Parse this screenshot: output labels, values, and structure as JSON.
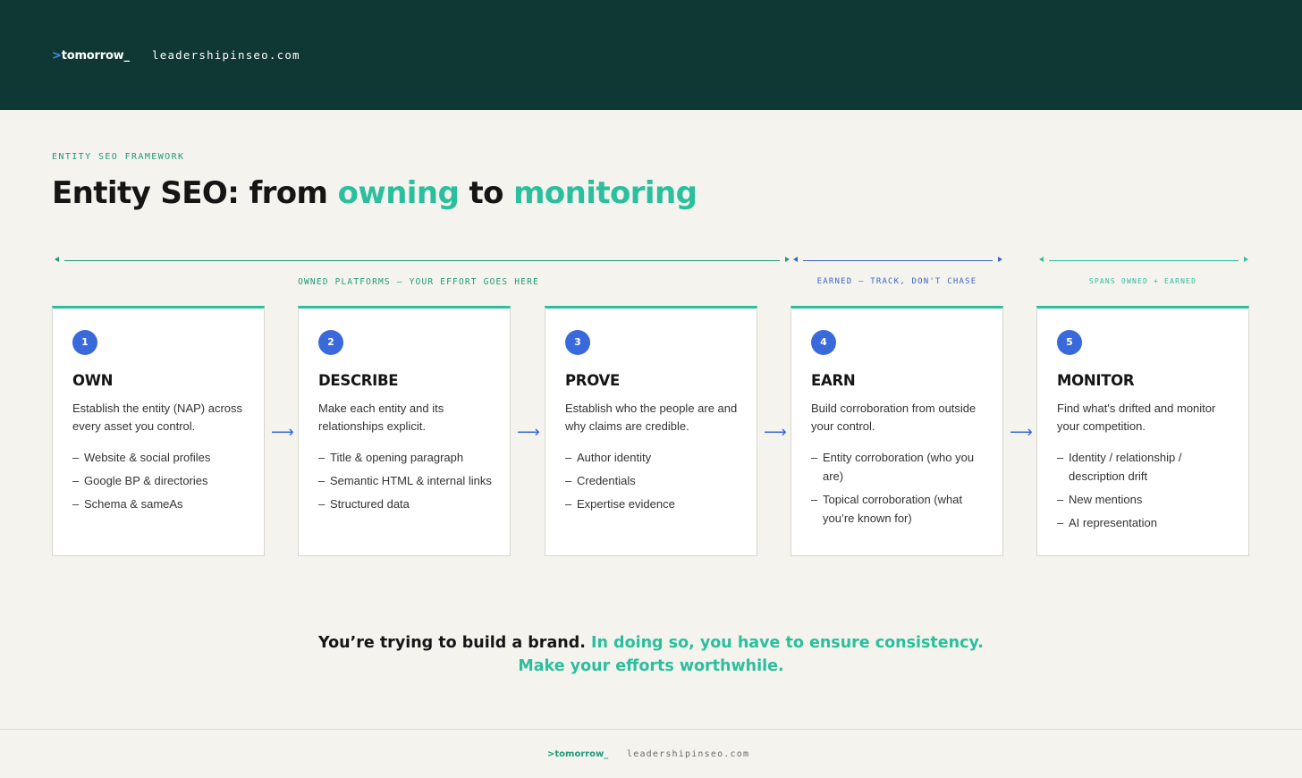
{
  "header": {
    "brand_prefix": ">",
    "brand_name": "tomorrow_",
    "site": "leadershipinseo.com"
  },
  "eyebrow": "ENTITY SEO FRAMEWORK",
  "title": {
    "part1": "Entity SEO: from ",
    "highlight1": "owning",
    "part2": " to ",
    "highlight2": "monitoring"
  },
  "brackets": {
    "owned": "OWNED PLATFORMS — YOUR EFFORT GOES HERE",
    "earned": "EARNED — TRACK, DON'T CHASE",
    "spans": "SPANS OWNED + EARNED"
  },
  "steps": [
    {
      "number": "1",
      "title": "OWN",
      "description": "Establish the entity (NAP) across every asset you control.",
      "items": [
        "Website & social profiles",
        "Google BP & directories",
        "Schema & sameAs"
      ]
    },
    {
      "number": "2",
      "title": "DESCRIBE",
      "description": "Make each entity and its relationships explicit.",
      "items": [
        "Title & opening paragraph",
        "Semantic HTML & internal links",
        "Structured data"
      ]
    },
    {
      "number": "3",
      "title": "PROVE",
      "description": "Establish who the people are and why claims are credible.",
      "items": [
        "Author identity",
        "Credentials",
        "Expertise evidence"
      ]
    },
    {
      "number": "4",
      "title": "EARN",
      "description": "Build corroboration from outside your control.",
      "items": [
        "Entity corroboration (who you are)",
        "Topical corroboration (what you’re known for)"
      ]
    },
    {
      "number": "5",
      "title": "MONITOR",
      "description": "Find what's drifted and monitor your competition.",
      "items": [
        "Identity / relationship / description drift",
        "New mentions",
        "AI representation"
      ]
    }
  ],
  "arrow_glyph": "⟶",
  "tagline": {
    "part1": "You’re trying to build a brand. ",
    "highlight1": "In doing so, you have to ensure consistency.",
    "highlight2": "Make your efforts worthwhile."
  },
  "footer": {
    "brand": ">tomorrow_",
    "site": "leadershipinseo.com"
  },
  "colors": {
    "header_bg": "#0f3733",
    "page_bg": "#f5f3ee",
    "teal": "#2bbf9e",
    "green": "#1f9a78",
    "blue": "#3a69db"
  }
}
